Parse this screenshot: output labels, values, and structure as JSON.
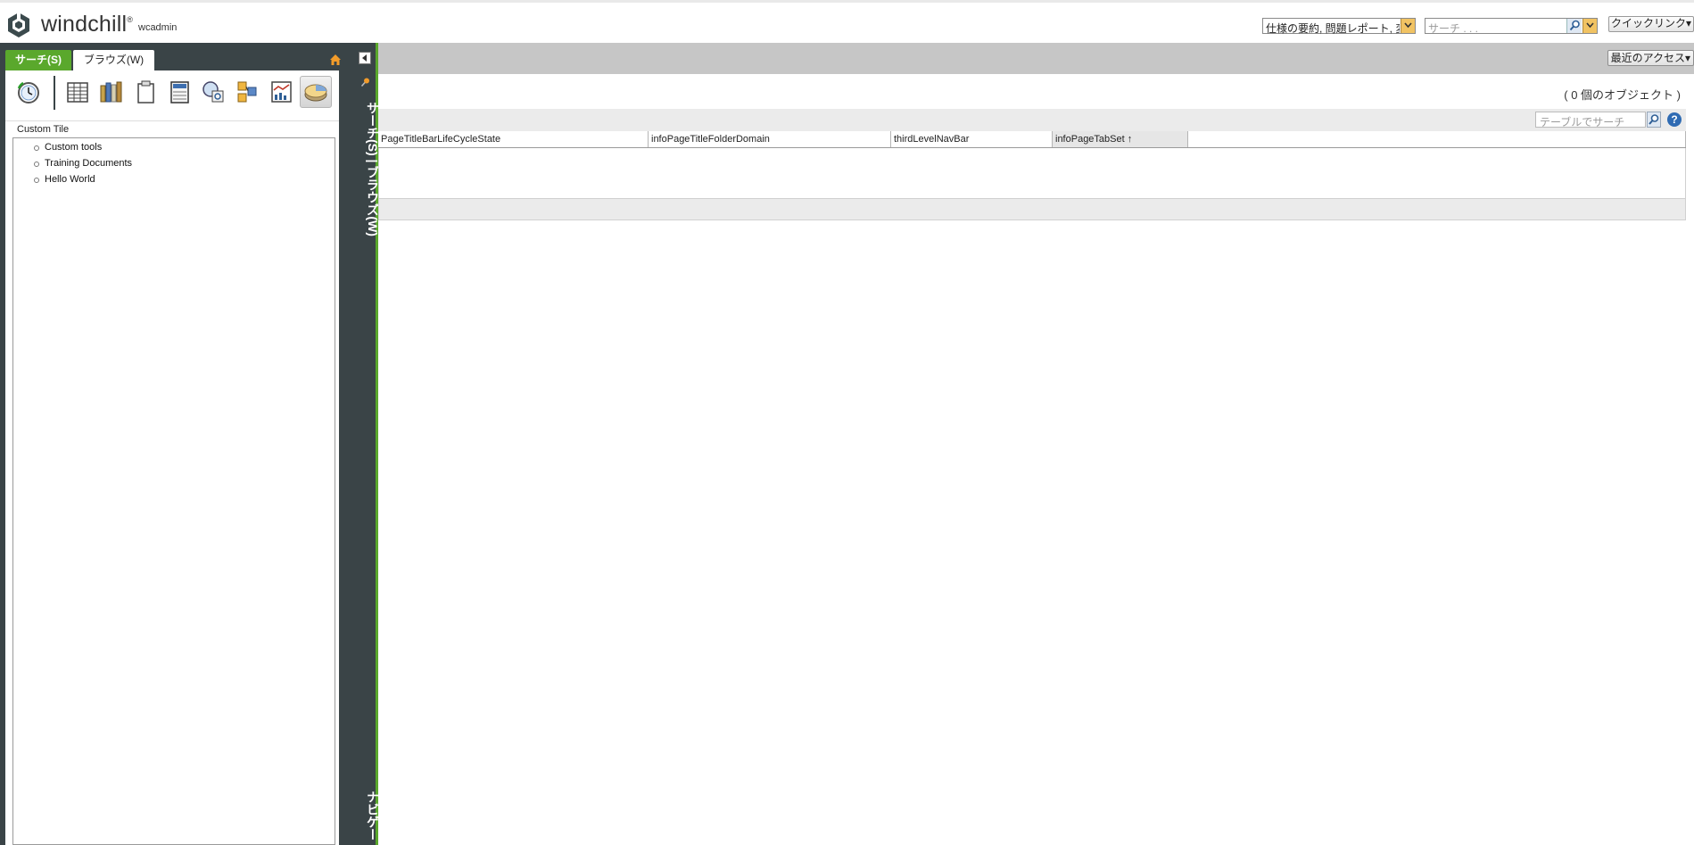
{
  "header": {
    "brand": "windchill",
    "brand_mark": "®",
    "user": "wcadmin",
    "search_type_value": "仕様の要約, 問題レポート, 変",
    "search_placeholder": "サーチ . . .",
    "quick_links": "クイックリンク",
    "icons": [
      "windchill-logo-icon",
      "search-icon",
      "chevron-down-icon"
    ]
  },
  "navigator": {
    "tabs": [
      {
        "label": "サーチ(S)",
        "active": true
      },
      {
        "label": "ブラウズ(W)",
        "active": false
      }
    ],
    "toolbar_icons": [
      "recent-clock-icon",
      "table-icon",
      "library-books-icon",
      "clipboard-icon",
      "calculator-icon",
      "search-globe-icon",
      "folder-structure-icon",
      "report-chart-icon",
      "disk-pie-icon"
    ],
    "custom_tile_title": "Custom Tile",
    "tile_items": [
      "Custom tools",
      "Training Documents",
      "Hello World"
    ]
  },
  "strip": {
    "label_top": "サーチ(S) | ブラウズ(W)",
    "label_bottom": "ナビゲー"
  },
  "main": {
    "recent_access": "最近のアクセス",
    "object_count": "( 0 個のオブジェクト )",
    "table_search_placeholder": "テーブルでサーチ",
    "columns": [
      {
        "label": "PageTitleBarLifeCycleState"
      },
      {
        "label": "infoPageTitleFolderDomain"
      },
      {
        "label": "thirdLevelNavBar"
      },
      {
        "label": "infoPageTabSet ↑",
        "sorted": true
      },
      {
        "label": ""
      }
    ]
  },
  "colors": {
    "accent_green": "#5aa82c",
    "nav_dark": "#3a4447",
    "toolbar_gray": "#c6c6c6",
    "dropdown_orange": "#f1c363"
  }
}
